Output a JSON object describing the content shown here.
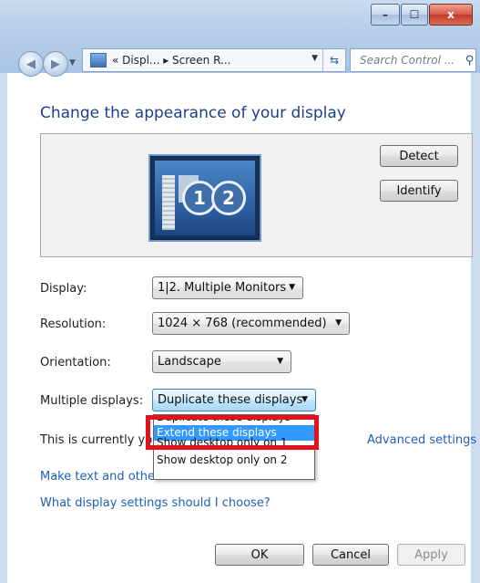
{
  "window": {
    "caption_buttons": {
      "min_label": "–",
      "max_label": "☐",
      "close_label": "x"
    }
  },
  "nav": {
    "back_icon": "arrow-left-icon",
    "forward_icon": "arrow-right-icon",
    "address_path": "« Displ... ▸ Screen R...",
    "search_placeholder": "Search Control ..."
  },
  "heading": "Change the appearance of your display",
  "preview": {
    "monitor_1": "1",
    "monitor_2": "2",
    "detect_label": "Detect",
    "identify_label": "Identify"
  },
  "settings": {
    "display_label": "Display:",
    "display_value": "1|2. Multiple Monitors",
    "resolution_label": "Resolution:",
    "resolution_value": "1024 × 768 (recommended)",
    "orientation_label": "Orientation:",
    "orientation_value": "Landscape",
    "multiple_label": "Multiple displays:",
    "multiple_value": "Duplicate these displays"
  },
  "dropdown": {
    "items": [
      "Duplicate these displays",
      "Extend these displays",
      "Show desktop only on 1",
      "Show desktop only on 2"
    ],
    "selected_index": 1
  },
  "status_text": "This is currently yo",
  "links": {
    "advanced": "Advanced settings",
    "make_text": "Make text and other",
    "what_settings": "What display settings should I choose?"
  },
  "footer": {
    "ok": "OK",
    "cancel": "Cancel",
    "apply": "Apply"
  },
  "colors": {
    "heading": "#1e3f8a",
    "link": "#1d5fb8",
    "selection": "#3399ff",
    "highlight_box": "#e3121f"
  }
}
